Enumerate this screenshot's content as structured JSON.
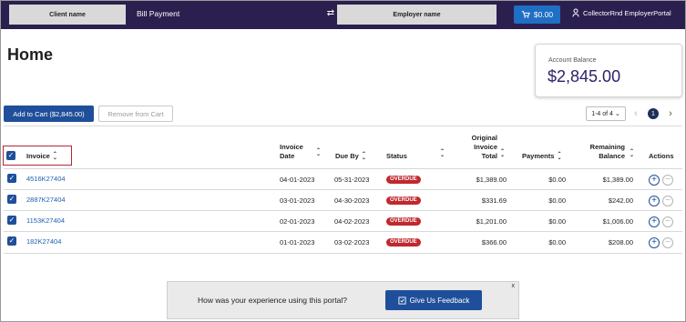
{
  "header": {
    "client_name": "Client name",
    "app_title": "Bill Payment",
    "employer_name": "Employer name",
    "cart_total": "$0.00",
    "user_name": "CollectorRnd EmployerPortal"
  },
  "page": {
    "title": "Home"
  },
  "account_balance": {
    "label": "Account Balance",
    "value": "$2,845.00"
  },
  "actions": {
    "add_to_cart": "Add to Cart ($2,845.00)",
    "remove_from_cart": "Remove from Cart"
  },
  "pagination": {
    "range": "1-4 of 4",
    "current_page": "1"
  },
  "table": {
    "headers": {
      "invoice": "Invoice",
      "invoice_date_l1": "Invoice",
      "invoice_date_l2": "Date",
      "due_by": "Due By",
      "status": "Status",
      "original_l1": "Original",
      "original_l2": "Invoice",
      "original_l3": "Total",
      "payments": "Payments",
      "remaining_l1": "Remaining",
      "remaining_l2": "Balance",
      "actions": "Actions"
    },
    "rows": [
      {
        "invoice": "4516K27404",
        "invoice_date": "04-01-2023",
        "due_by": "05-31-2023",
        "status": "OVERDUE",
        "original_total": "$1,389.00",
        "payments": "$0.00",
        "remaining": "$1,389.00"
      },
      {
        "invoice": "2887K27404",
        "invoice_date": "03-01-2023",
        "due_by": "04-30-2023",
        "status": "OVERDUE",
        "original_total": "$331.69",
        "payments": "$0.00",
        "remaining": "$242.00"
      },
      {
        "invoice": "1153K27404",
        "invoice_date": "02-01-2023",
        "due_by": "04-02-2023",
        "status": "OVERDUE",
        "original_total": "$1,201.00",
        "payments": "$0.00",
        "remaining": "$1,006.00"
      },
      {
        "invoice": "182K27404",
        "invoice_date": "01-01-2023",
        "due_by": "03-02-2023",
        "status": "OVERDUE",
        "original_total": "$366.00",
        "payments": "$0.00",
        "remaining": "$208.00"
      }
    ]
  },
  "feedback": {
    "question": "How was your experience using this portal?",
    "button": "Give Us Feedback",
    "close": "x"
  },
  "colors": {
    "header_bg": "#2b1f4f",
    "primary": "#1f4f9a",
    "link": "#1f5fae",
    "overdue": "#c0282e",
    "balance_text": "#2b1f6a"
  }
}
